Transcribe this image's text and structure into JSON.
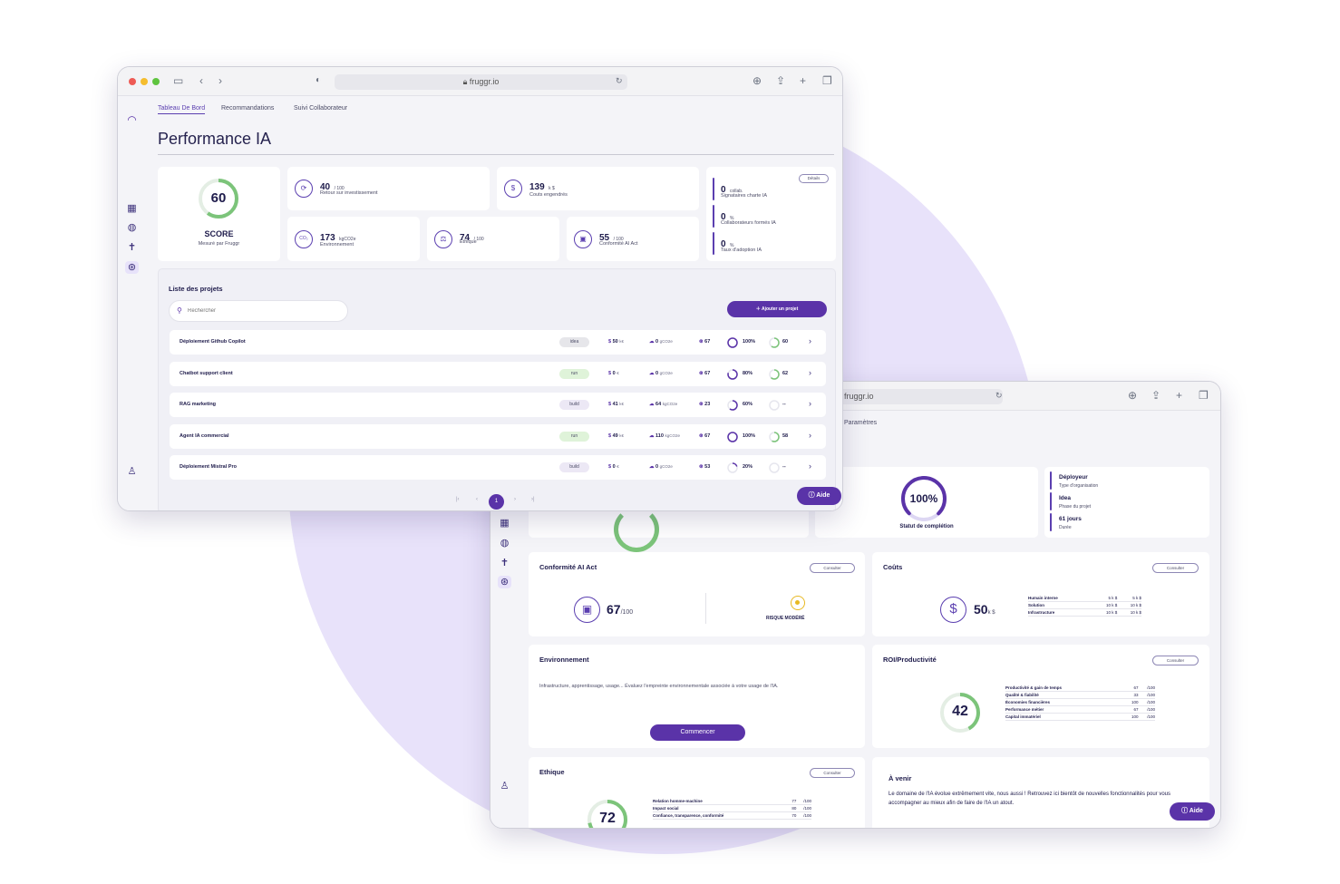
{
  "browser": {
    "url_front": "fruggr.io",
    "url_back": "fruggr.io"
  },
  "tabs": [
    "Tableau De Bord",
    "Recommandations",
    "Suivi Collaborateur"
  ],
  "page_title": "Performance IA",
  "score": {
    "value": "60",
    "label": "SCORE",
    "sub": "Mesuré par Fruggr",
    "fraction": 0.6
  },
  "kpis": {
    "roi": {
      "value": "40",
      "unit": "/ 100",
      "label": "Retour sur investissement"
    },
    "couts": {
      "value": "139",
      "unit": "k $",
      "label": "Couts engendrés"
    },
    "env": {
      "value": "173",
      "unit": "kgCO2e",
      "label": "Environnement",
      "icon_text": "CO₂"
    },
    "ethique": {
      "value": "74",
      "unit": "/ 100",
      "label": "Ethique"
    },
    "conformite": {
      "value": "55",
      "unit": "/ 100",
      "label": "Conformité AI Act"
    }
  },
  "collab": {
    "details_label": "Détails",
    "items": [
      {
        "value": "0",
        "unit": "collab.",
        "label": "Signataires charte IA"
      },
      {
        "value": "0",
        "unit": "%",
        "label": "Collaborateurs formés IA"
      },
      {
        "value": "0",
        "unit": "%",
        "label": "Taux d'adoption IA"
      }
    ]
  },
  "projects": {
    "title": "Liste des projets",
    "search_placeholder": "Rechercher",
    "add_label": "Ajouter un projet",
    "rows": [
      {
        "name": "Déploiement Github Copilot",
        "stage": "idea",
        "cost": "50",
        "cost_unit": "k€",
        "co2": "0",
        "co2_unit": "gCO2e",
        "score": "67",
        "pct": "100%",
        "pct_frac": 1.0,
        "val": "60",
        "val_frac": 0.6
      },
      {
        "name": "Chatbot support client",
        "stage": "run",
        "cost": "0",
        "cost_unit": "€",
        "co2": "0",
        "co2_unit": "gCO2e",
        "score": "67",
        "pct": "80%",
        "pct_frac": 0.8,
        "val": "62",
        "val_frac": 0.62
      },
      {
        "name": "RAG marketing",
        "stage": "build",
        "cost": "41",
        "cost_unit": "k€",
        "co2": "64",
        "co2_unit": "kgCO2e",
        "score": "23",
        "pct": "60%",
        "pct_frac": 0.6,
        "val": "--",
        "val_frac": 0
      },
      {
        "name": "Agent IA commercial",
        "stage": "run",
        "cost": "49",
        "cost_unit": "k€",
        "co2": "110",
        "co2_unit": "kgCO2e",
        "score": "67",
        "pct": "100%",
        "pct_frac": 1.0,
        "val": "58",
        "val_frac": 0.58
      },
      {
        "name": "Déploiement Mistral Pro",
        "stage": "build",
        "cost": "0",
        "cost_unit": "€",
        "co2": "0",
        "co2_unit": "gCO2e",
        "score": "53",
        "pct": "20%",
        "pct_frac": 0.2,
        "val": "--",
        "val_frac": 0
      }
    ],
    "pagination": {
      "current": "1"
    }
  },
  "aide_label": "Aide",
  "detail": {
    "tab_label": "Paramètres",
    "completion": {
      "value": "100%",
      "label": "Statut de complétion",
      "fraction": 1.0
    },
    "info": [
      {
        "value": "Déployeur",
        "label": "Type d'organisation"
      },
      {
        "value": "Idea",
        "label": "Phase du projet"
      },
      {
        "value": "61 jours",
        "label": "Durée"
      }
    ],
    "consult_label": "Consulter",
    "ai_act": {
      "title": "Conformité AI Act",
      "value": "67",
      "unit": "/100",
      "risk": "RISQUE MODÉRÉ"
    },
    "couts": {
      "title": "Coûts",
      "value": "50",
      "unit": "k $",
      "rows": [
        {
          "name": "Humain interne",
          "a": "5 k $",
          "b": "5 k $"
        },
        {
          "name": "Solution",
          "a": "10 k $",
          "b": "10 k $"
        },
        {
          "name": "Infrastructure",
          "a": "10 k $",
          "b": "10 k $"
        }
      ]
    },
    "env": {
      "title": "Environnement",
      "text": "Infrastructure, apprentissage, usage... Évaluez l'empreinte environnementale associée à votre usage de l'IA.",
      "button": "Commencer"
    },
    "roi": {
      "title": "ROI/Productivité",
      "value": "42",
      "fraction": 0.42,
      "rows": [
        {
          "name": "Productivité & gain de temps",
          "v": "67",
          "u": "/100"
        },
        {
          "name": "Qualité & fiabilité",
          "v": "33",
          "u": "/100"
        },
        {
          "name": "Économies financières",
          "v": "100",
          "u": "/100"
        },
        {
          "name": "Performance métier",
          "v": "67",
          "u": "/100"
        },
        {
          "name": "Capital immatériel",
          "v": "100",
          "u": "/100"
        }
      ]
    },
    "ethique": {
      "title": "Ethique",
      "value": "72",
      "fraction": 0.72,
      "rows": [
        {
          "name": "Relation homme-machine",
          "v": "77",
          "u": "/100"
        },
        {
          "name": "Impact social",
          "v": "80",
          "u": "/100"
        },
        {
          "name": "Confiance, transparence, conformité",
          "v": "70",
          "u": "/100"
        }
      ]
    },
    "avenir": {
      "title": "À venir",
      "text": "Le domaine de l'IA évolue extrêmement vite, nous aussi ! Retrouvez ici bientôt de nouvelles fonctionnalités pour vous accompagner au mieux afin de faire de l'IA un atout."
    }
  },
  "colors": {
    "accent": "#5a33a8",
    "green": "#7cc47a",
    "lavender": "#e8e2fa"
  }
}
